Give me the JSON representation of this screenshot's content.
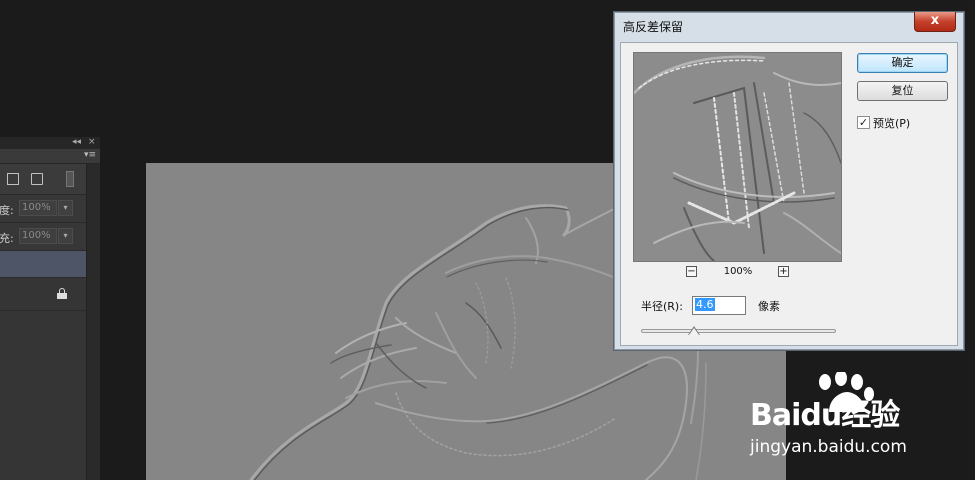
{
  "layers_panel": {
    "collapse_icon": "double-chevron-icon",
    "close_label": "×",
    "menu_icon": "panel-menu-icon",
    "opacity": {
      "label": "度:",
      "value": "100%"
    },
    "fill": {
      "label": "充:",
      "value": "100%"
    },
    "lock_icon": "lock-icon"
  },
  "dialog": {
    "title": "高反差保留",
    "close_label": "x",
    "ok_label": "确定",
    "reset_label": "复位",
    "preview_checkbox": {
      "checked": true,
      "label": "预览(P)"
    },
    "zoom": {
      "minus": "−",
      "level": "100%",
      "plus": "+"
    },
    "radius": {
      "label": "半径(R):",
      "value": "4.6",
      "unit": "像素",
      "slider_fraction": 0.27
    }
  },
  "watermark": {
    "logo_text": "Baidu经验",
    "url": "jingyan.baidu.com"
  }
}
